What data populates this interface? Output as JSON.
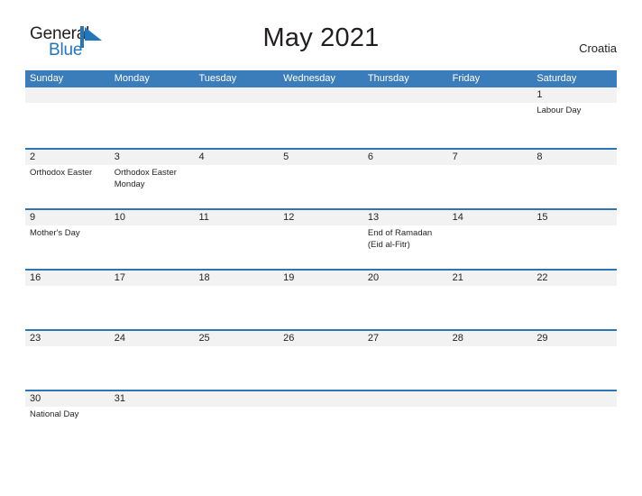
{
  "logo": {
    "word_one": "General",
    "word_two": "Blue",
    "mark": "triangle-flag-icon",
    "colors": {
      "text": "#231f20",
      "blue": "#2277bb"
    }
  },
  "header": {
    "title": "May 2021",
    "locale": "Croatia"
  },
  "colors": {
    "header_blue": "#3b7cba",
    "row_rule": "#2e75b6",
    "band_gray": "#f2f2f2",
    "text": "#231f20"
  },
  "calendar": {
    "day_names": [
      "Sunday",
      "Monday",
      "Tuesday",
      "Wednesday",
      "Thursday",
      "Friday",
      "Saturday"
    ],
    "weeks": [
      [
        {
          "day": "",
          "events": []
        },
        {
          "day": "",
          "events": []
        },
        {
          "day": "",
          "events": []
        },
        {
          "day": "",
          "events": []
        },
        {
          "day": "",
          "events": []
        },
        {
          "day": "",
          "events": []
        },
        {
          "day": "1",
          "events": [
            "Labour Day"
          ]
        }
      ],
      [
        {
          "day": "2",
          "events": [
            "Orthodox Easter"
          ]
        },
        {
          "day": "3",
          "events": [
            "Orthodox Easter Monday"
          ]
        },
        {
          "day": "4",
          "events": []
        },
        {
          "day": "5",
          "events": []
        },
        {
          "day": "6",
          "events": []
        },
        {
          "day": "7",
          "events": []
        },
        {
          "day": "8",
          "events": []
        }
      ],
      [
        {
          "day": "9",
          "events": [
            "Mother's Day"
          ]
        },
        {
          "day": "10",
          "events": []
        },
        {
          "day": "11",
          "events": []
        },
        {
          "day": "12",
          "events": []
        },
        {
          "day": "13",
          "events": [
            "End of Ramadan (Eid al-Fitr)"
          ]
        },
        {
          "day": "14",
          "events": []
        },
        {
          "day": "15",
          "events": []
        }
      ],
      [
        {
          "day": "16",
          "events": []
        },
        {
          "day": "17",
          "events": []
        },
        {
          "day": "18",
          "events": []
        },
        {
          "day": "19",
          "events": []
        },
        {
          "day": "20",
          "events": []
        },
        {
          "day": "21",
          "events": []
        },
        {
          "day": "22",
          "events": []
        }
      ],
      [
        {
          "day": "23",
          "events": []
        },
        {
          "day": "24",
          "events": []
        },
        {
          "day": "25",
          "events": []
        },
        {
          "day": "26",
          "events": []
        },
        {
          "day": "27",
          "events": []
        },
        {
          "day": "28",
          "events": []
        },
        {
          "day": "29",
          "events": []
        }
      ],
      [
        {
          "day": "30",
          "events": [
            "National Day"
          ]
        },
        {
          "day": "31",
          "events": []
        },
        {
          "day": "",
          "events": []
        },
        {
          "day": "",
          "events": []
        },
        {
          "day": "",
          "events": []
        },
        {
          "day": "",
          "events": []
        },
        {
          "day": "",
          "events": []
        }
      ]
    ]
  }
}
